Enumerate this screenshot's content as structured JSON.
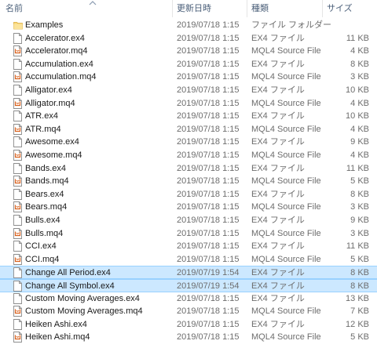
{
  "columns": {
    "name": "名前",
    "modified": "更新日時",
    "type": "種類",
    "size": "サイズ"
  },
  "files": [
    {
      "name": "Examples",
      "modified": "2019/07/18 1:15",
      "type": "ファイル フォルダー",
      "size": "",
      "icon": "folder-icon"
    },
    {
      "name": "Accelerator.ex4",
      "modified": "2019/07/18 1:15",
      "type": "EX4 ファイル",
      "size": "11 KB",
      "icon": "file-icon"
    },
    {
      "name": "Accelerator.mq4",
      "modified": "2019/07/18 1:15",
      "type": "MQL4 Source File",
      "size": "4 KB",
      "icon": "mq4-file-icon"
    },
    {
      "name": "Accumulation.ex4",
      "modified": "2019/07/18 1:15",
      "type": "EX4 ファイル",
      "size": "8 KB",
      "icon": "file-icon"
    },
    {
      "name": "Accumulation.mq4",
      "modified": "2019/07/18 1:15",
      "type": "MQL4 Source File",
      "size": "3 KB",
      "icon": "mq4-file-icon"
    },
    {
      "name": "Alligator.ex4",
      "modified": "2019/07/18 1:15",
      "type": "EX4 ファイル",
      "size": "10 KB",
      "icon": "file-icon"
    },
    {
      "name": "Alligator.mq4",
      "modified": "2019/07/18 1:15",
      "type": "MQL4 Source File",
      "size": "4 KB",
      "icon": "mq4-file-icon"
    },
    {
      "name": "ATR.ex4",
      "modified": "2019/07/18 1:15",
      "type": "EX4 ファイル",
      "size": "10 KB",
      "icon": "file-icon"
    },
    {
      "name": "ATR.mq4",
      "modified": "2019/07/18 1:15",
      "type": "MQL4 Source File",
      "size": "4 KB",
      "icon": "mq4-file-icon"
    },
    {
      "name": "Awesome.ex4",
      "modified": "2019/07/18 1:15",
      "type": "EX4 ファイル",
      "size": "9 KB",
      "icon": "file-icon"
    },
    {
      "name": "Awesome.mq4",
      "modified": "2019/07/18 1:15",
      "type": "MQL4 Source File",
      "size": "4 KB",
      "icon": "mq4-file-icon"
    },
    {
      "name": "Bands.ex4",
      "modified": "2019/07/18 1:15",
      "type": "EX4 ファイル",
      "size": "11 KB",
      "icon": "file-icon"
    },
    {
      "name": "Bands.mq4",
      "modified": "2019/07/18 1:15",
      "type": "MQL4 Source File",
      "size": "5 KB",
      "icon": "mq4-file-icon"
    },
    {
      "name": "Bears.ex4",
      "modified": "2019/07/18 1:15",
      "type": "EX4 ファイル",
      "size": "8 KB",
      "icon": "file-icon"
    },
    {
      "name": "Bears.mq4",
      "modified": "2019/07/18 1:15",
      "type": "MQL4 Source File",
      "size": "3 KB",
      "icon": "mq4-file-icon"
    },
    {
      "name": "Bulls.ex4",
      "modified": "2019/07/18 1:15",
      "type": "EX4 ファイル",
      "size": "9 KB",
      "icon": "file-icon"
    },
    {
      "name": "Bulls.mq4",
      "modified": "2019/07/18 1:15",
      "type": "MQL4 Source File",
      "size": "3 KB",
      "icon": "mq4-file-icon"
    },
    {
      "name": "CCI.ex4",
      "modified": "2019/07/18 1:15",
      "type": "EX4 ファイル",
      "size": "11 KB",
      "icon": "file-icon"
    },
    {
      "name": "CCI.mq4",
      "modified": "2019/07/18 1:15",
      "type": "MQL4 Source File",
      "size": "5 KB",
      "icon": "mq4-file-icon"
    },
    {
      "name": "Change All Period.ex4",
      "modified": "2019/07/19 1:54",
      "type": "EX4 ファイル",
      "size": "8 KB",
      "icon": "file-icon",
      "selected": true
    },
    {
      "name": "Change All Symbol.ex4",
      "modified": "2019/07/19 1:54",
      "type": "EX4 ファイル",
      "size": "8 KB",
      "icon": "file-icon",
      "selected": true
    },
    {
      "name": "Custom Moving Averages.ex4",
      "modified": "2019/07/18 1:15",
      "type": "EX4 ファイル",
      "size": "13 KB",
      "icon": "file-icon"
    },
    {
      "name": "Custom Moving Averages.mq4",
      "modified": "2019/07/18 1:15",
      "type": "MQL4 Source File",
      "size": "7 KB",
      "icon": "mq4-file-icon"
    },
    {
      "name": "Heiken Ashi.ex4",
      "modified": "2019/07/18 1:15",
      "type": "EX4 ファイル",
      "size": "12 KB",
      "icon": "file-icon"
    },
    {
      "name": "Heiken Ashi.mq4",
      "modified": "2019/07/18 1:15",
      "type": "MQL4 Source File",
      "size": "5 KB",
      "icon": "mq4-file-icon"
    }
  ]
}
